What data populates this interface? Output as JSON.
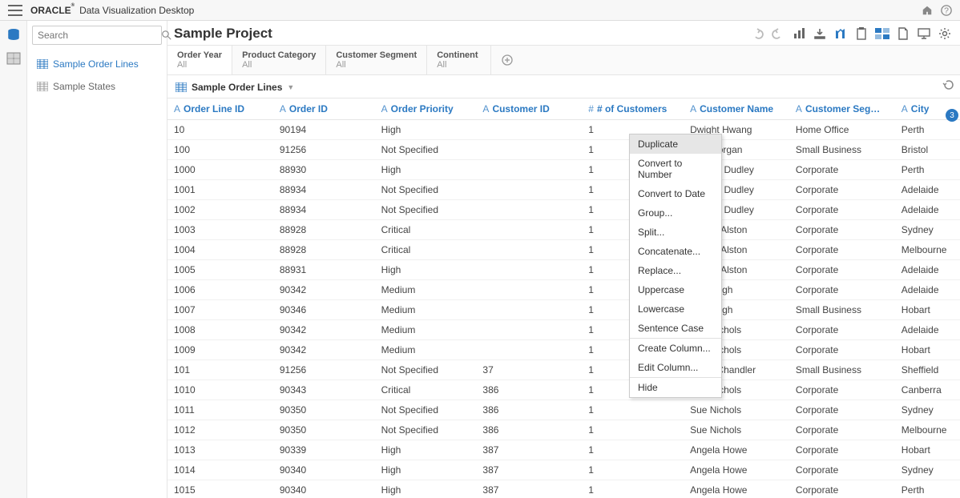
{
  "app": {
    "brand": "ORACLE",
    "product": "Data Visualization Desktop"
  },
  "search": {
    "placeholder": "Search"
  },
  "datasets": [
    {
      "label": "Sample Order Lines",
      "active": true
    },
    {
      "label": "Sample States",
      "active": false
    }
  ],
  "project": {
    "title": "Sample Project"
  },
  "filters": [
    {
      "label": "Order Year",
      "value": "All"
    },
    {
      "label": "Product Category",
      "value": "All"
    },
    {
      "label": "Customer Segment",
      "value": "All"
    },
    {
      "label": "Continent",
      "value": "All"
    }
  ],
  "table": {
    "title": "Sample Order Lines",
    "columns": [
      {
        "type": "A",
        "label": "Order Line ID"
      },
      {
        "type": "A",
        "label": "Order ID"
      },
      {
        "type": "A",
        "label": "Order Priority"
      },
      {
        "type": "A",
        "label": "Customer ID"
      },
      {
        "type": "#",
        "label": "# of Customers"
      },
      {
        "type": "A",
        "label": "Customer Name"
      },
      {
        "type": "A",
        "label": "Customer Seg…"
      },
      {
        "type": "A",
        "label": "City"
      }
    ],
    "rows": [
      [
        "10",
        "90194",
        "High",
        "",
        "1",
        "Dwight Hwang",
        "Home Office",
        "Perth"
      ],
      [
        "100",
        "91256",
        "Not Specified",
        "",
        "1",
        "Ray Morgan",
        "Small Business",
        "Bristol"
      ],
      [
        "1000",
        "88930",
        "High",
        "",
        "1",
        "Wesley Dudley",
        "Corporate",
        "Perth"
      ],
      [
        "1001",
        "88934",
        "Not Specified",
        "",
        "1",
        "Wesley Dudley",
        "Corporate",
        "Adelaide"
      ],
      [
        "1002",
        "88934",
        "Not Specified",
        "",
        "1",
        "Wesley Dudley",
        "Corporate",
        "Adelaide"
      ],
      [
        "1003",
        "88928",
        "Critical",
        "",
        "1",
        "Renee Alston",
        "Corporate",
        "Sydney"
      ],
      [
        "1004",
        "88928",
        "Critical",
        "",
        "1",
        "Renee Alston",
        "Corporate",
        "Melbourne"
      ],
      [
        "1005",
        "88931",
        "High",
        "",
        "1",
        "Renee Alston",
        "Corporate",
        "Adelaide"
      ],
      [
        "1006",
        "90342",
        "Medium",
        "",
        "1",
        "Jose High",
        "Corporate",
        "Adelaide"
      ],
      [
        "1007",
        "90346",
        "Medium",
        "",
        "1",
        "Jose High",
        "Small Business",
        "Hobart"
      ],
      [
        "1008",
        "90342",
        "Medium",
        "",
        "1",
        "Sue Nichols",
        "Corporate",
        "Adelaide"
      ],
      [
        "1009",
        "90342",
        "Medium",
        "",
        "1",
        "Sue Nichols",
        "Corporate",
        "Hobart"
      ],
      [
        "101",
        "91256",
        "Not Specified",
        "37",
        "1",
        "Stacy Chandler",
        "Small Business",
        "Sheffield"
      ],
      [
        "1010",
        "90343",
        "Critical",
        "386",
        "1",
        "Sue Nichols",
        "Corporate",
        "Canberra"
      ],
      [
        "1011",
        "90350",
        "Not Specified",
        "386",
        "1",
        "Sue Nichols",
        "Corporate",
        "Sydney"
      ],
      [
        "1012",
        "90350",
        "Not Specified",
        "386",
        "1",
        "Sue Nichols",
        "Corporate",
        "Melbourne"
      ],
      [
        "1013",
        "90339",
        "High",
        "387",
        "1",
        "Angela Howe",
        "Corporate",
        "Hobart"
      ],
      [
        "1014",
        "90340",
        "High",
        "387",
        "1",
        "Angela Howe",
        "Corporate",
        "Sydney"
      ],
      [
        "1015",
        "90340",
        "High",
        "387",
        "1",
        "Angela Howe",
        "Corporate",
        "Perth"
      ]
    ]
  },
  "context_menu": {
    "items": [
      "Duplicate",
      "Convert to Number",
      "Convert to Date",
      "Group...",
      "Split...",
      "Concatenate...",
      "Replace...",
      "Uppercase",
      "Lowercase",
      "Sentence Case",
      "-",
      "Create Column...",
      "Edit Column...",
      "-",
      "Hide"
    ],
    "selected_index": 0
  },
  "badge": "3",
  "colwidths": [
    "130",
    "125",
    "125",
    "130",
    "125",
    "130",
    "130",
    "80"
  ]
}
